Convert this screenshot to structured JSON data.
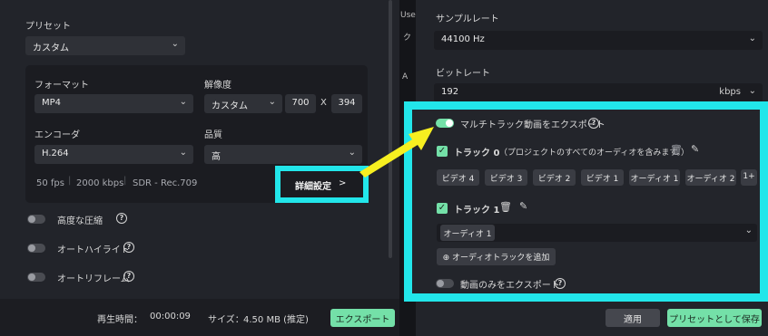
{
  "left": {
    "preset_label": "プリセット",
    "preset_value": "カスタム",
    "format_label": "フォーマット",
    "format_value": "MP4",
    "resolution_label": "解像度",
    "resolution_value": "カスタム",
    "width": "700",
    "x_sep": "X",
    "height": "394",
    "encoder_label": "エンコーダ",
    "encoder_value": "H.264",
    "quality_label": "品質",
    "quality_value": "高",
    "summary": [
      "50 fps",
      "2000 kbps",
      "SDR - Rec.709"
    ],
    "advanced_button": "詳細設定",
    "advanced_chevron": ">",
    "options": [
      {
        "label": "高度な圧縮"
      },
      {
        "label": "オートハイライト"
      },
      {
        "label": "オートリフレーム"
      }
    ],
    "help_glyph": "?",
    "playtime_label": "再生時間：",
    "playtime_value": "00:00:09",
    "size_label": "サイズ：",
    "size_value": "4.50 MB (推定)",
    "export_button": "エクスポート"
  },
  "strip": [
    "Use",
    "ク",
    "A"
  ],
  "right": {
    "sample_rate_label": "サンプルレート",
    "sample_rate_value": "44100 Hz",
    "bitrate_label": "ビットレート",
    "bitrate_value": "192",
    "bitrate_unit": "kbps",
    "multitrack_label": "マルチトラック動画をエクスポート",
    "track0_label": "トラック 0",
    "track0_desc": "（プロジェクトのすべてのオーディオを含みます。）",
    "track0_chips": [
      "ビデオ 4",
      "ビデオ 3",
      "ビデオ 2",
      "ビデオ 1",
      "オーディオ 1",
      "オーディオ 2",
      "1+"
    ],
    "track1_label": "トラック 1",
    "track1_chip": "オーディオ 1",
    "add_audio_track": "オーディオトラックを追加",
    "video_only_label": "動画のみをエクスポート",
    "apply_button": "適用",
    "save_preset_button": "プリセットとして保存"
  },
  "colors": {
    "highlight": "#22e6ea",
    "accent_green": "#74e0a8",
    "arrow_yellow": "#f7ef20"
  },
  "icons": {
    "check": "✓",
    "chevron": "⌄",
    "trash": "🗑",
    "edit": "✎",
    "plus_circle": "⊕"
  }
}
